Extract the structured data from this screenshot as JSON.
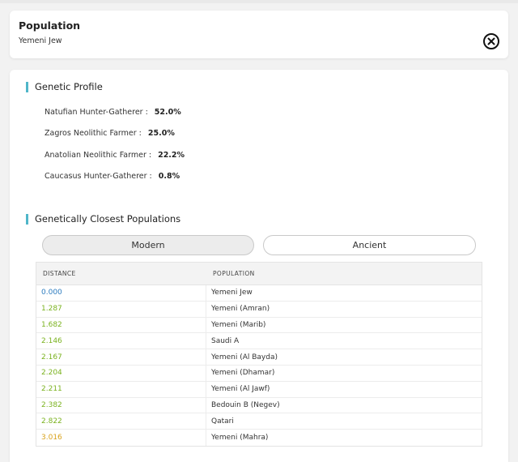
{
  "population_card": {
    "title": "Population",
    "name": "Yemeni Jew",
    "close_icon": "close-circle-icon"
  },
  "genetic_profile": {
    "title": "Genetic Profile",
    "components": [
      {
        "label": "Natufian Hunter-Gatherer :",
        "value": "52.0%"
      },
      {
        "label": "Zagros Neolithic Farmer :",
        "value": "25.0%"
      },
      {
        "label": "Anatolian Neolithic Farmer :",
        "value": "22.2%"
      },
      {
        "label": "Caucasus Hunter-Gatherer :",
        "value": "0.8%"
      }
    ]
  },
  "closest": {
    "title": "Genetically Closest Populations",
    "tabs": [
      {
        "label": "Modern",
        "selected": true
      },
      {
        "label": "Ancient",
        "selected": false
      }
    ],
    "table": {
      "headers": [
        "DISTANCE",
        "POPULATION"
      ],
      "rows": [
        {
          "distance": "0.000",
          "population": "Yemeni Jew",
          "color": "#2b7bbf"
        },
        {
          "distance": "1.287",
          "population": "Yemeni (Amran)",
          "color": "#7ab21e"
        },
        {
          "distance": "1.682",
          "population": "Yemeni (Marib)",
          "color": "#7ab21e"
        },
        {
          "distance": "2.146",
          "population": "Saudi A",
          "color": "#7ab21e"
        },
        {
          "distance": "2.167",
          "population": "Yemeni (Al Bayda)",
          "color": "#7ab21e"
        },
        {
          "distance": "2.204",
          "population": "Yemeni (Dhamar)",
          "color": "#7ab21e"
        },
        {
          "distance": "2.211",
          "population": "Yemeni (Al Jawf)",
          "color": "#7ab21e"
        },
        {
          "distance": "2.382",
          "population": "Bedouin B (Negev)",
          "color": "#7ab21e"
        },
        {
          "distance": "2.822",
          "population": "Qatari",
          "color": "#7ab21e"
        },
        {
          "distance": "3.016",
          "population": "Yemeni (Mahra)",
          "color": "#d9a21b"
        }
      ]
    }
  },
  "colors": {
    "accent": "#4fb6c9",
    "distance_exact": "#2b7bbf",
    "distance_close": "#7ab21e",
    "distance_far": "#d9a21b"
  }
}
